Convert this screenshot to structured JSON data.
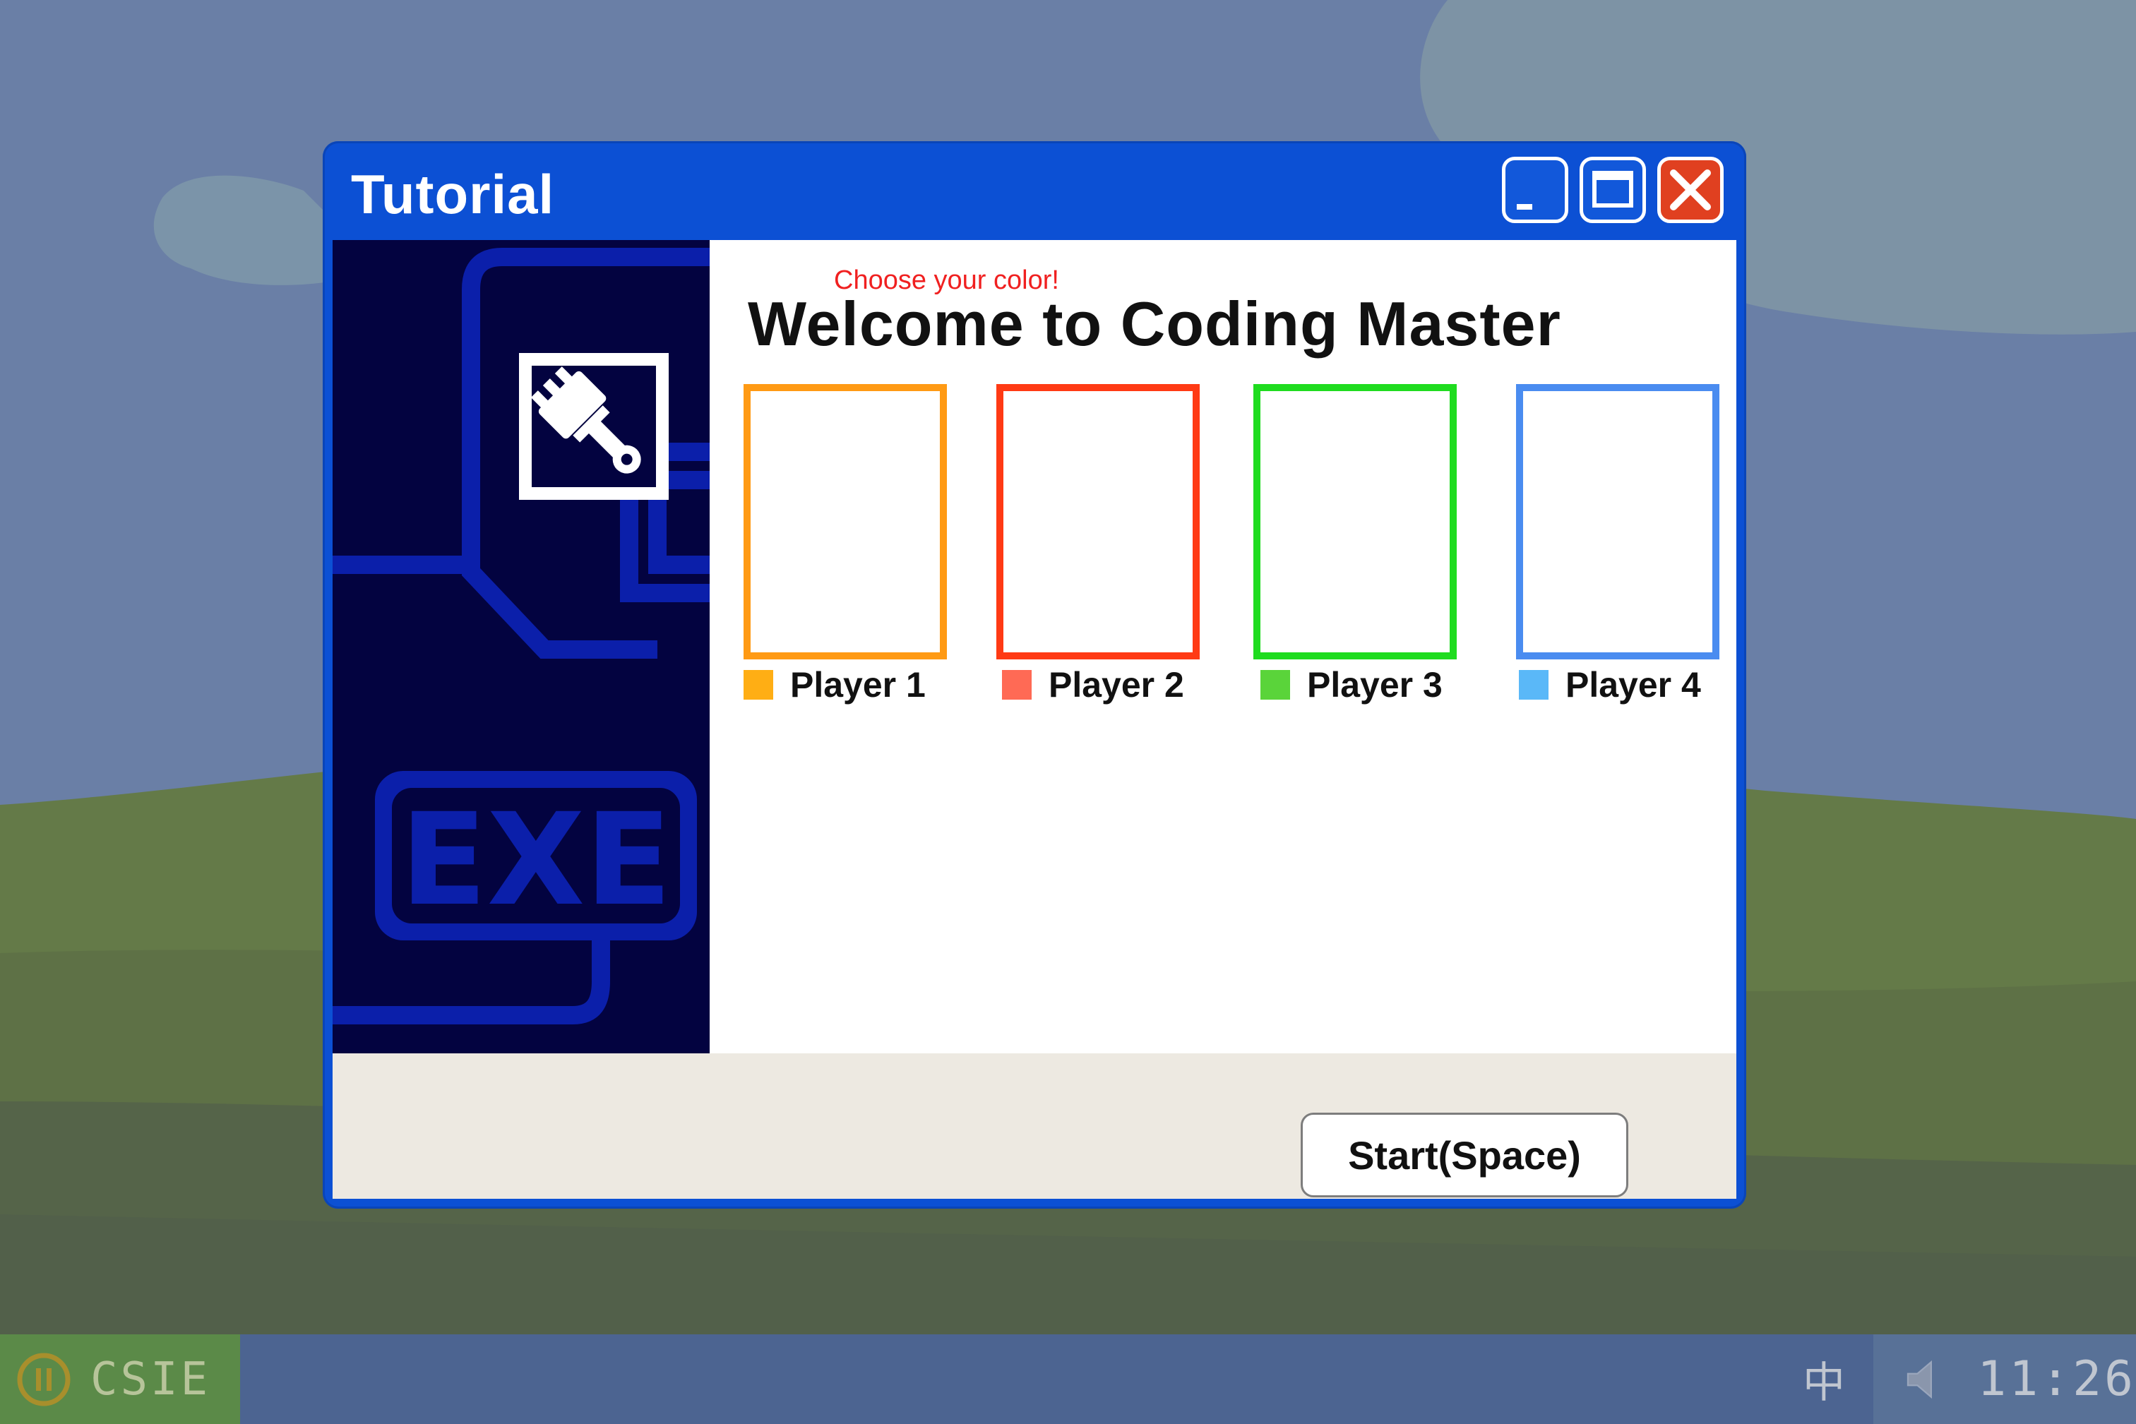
{
  "window": {
    "title": "Tutorial",
    "subtitle": "Choose your color!",
    "heading": "Welcome to Coding Master",
    "side_logo_text": "EXE",
    "start_button": "Start(Space)"
  },
  "players": [
    {
      "label": "Player 1",
      "border_color": "#ff9a14",
      "swatch_color": "#ffae14"
    },
    {
      "label": "Player 2",
      "border_color": "#ff3a14",
      "swatch_color": "#ff6a55"
    },
    {
      "label": "Player 3",
      "border_color": "#1fdc1f",
      "swatch_color": "#5ad43a"
    },
    {
      "label": "Player 4",
      "border_color": "#4a8cf0",
      "swatch_color": "#5ab8f8"
    }
  ],
  "taskbar": {
    "start_label": "CSIE",
    "ime_indicator": "中",
    "clock": "11:26"
  },
  "colors": {
    "title_bar": "#0c50d4",
    "side_panel": "#030340",
    "taskbar": "#4c6491",
    "start_button_bg": "#5b8a48"
  },
  "icons": {
    "window": "paintbrush-icon",
    "start": "pause-icon",
    "tray": "speaker-icon"
  }
}
